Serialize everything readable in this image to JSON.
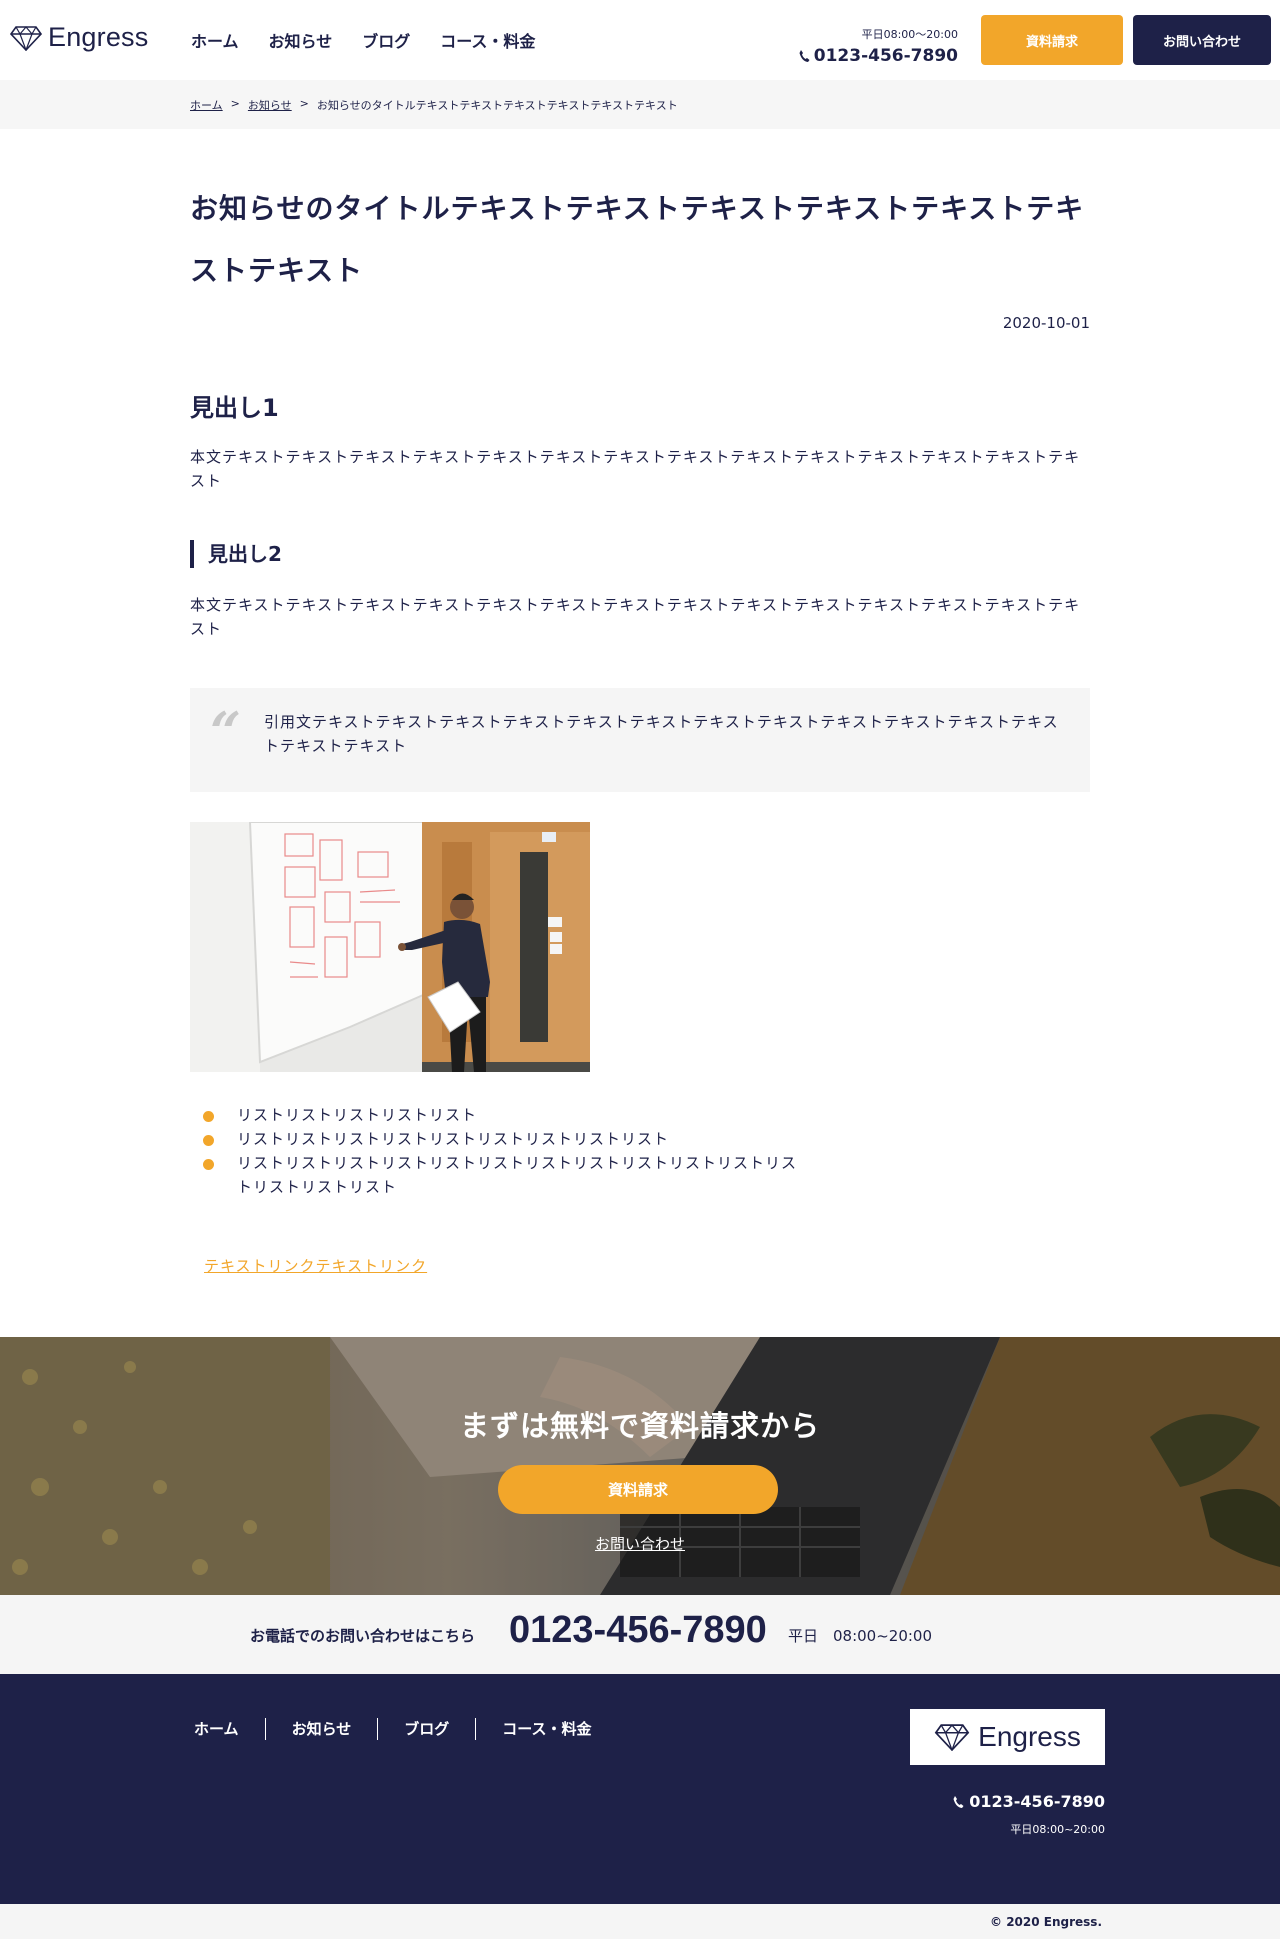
{
  "header": {
    "logo_text": "Engress",
    "nav": [
      "ホーム",
      "お知らせ",
      "ブログ",
      "コース・料金"
    ],
    "hours": "平日08:00〜20:00",
    "phone": "0123-456-7890",
    "doc_button": "資料請求",
    "contact_button": "お問い合わせ"
  },
  "breadcrumb": {
    "home": "ホーム",
    "sep": ">",
    "news": "お知らせ",
    "current": "お知らせのタイトルテキストテキストテキストテキストテキストテキスト"
  },
  "article": {
    "title": "お知らせのタイトルテキストテキストテキストテキストテキストテキストテキスト",
    "date": "2020-10-01",
    "heading1": "見出し1",
    "body1": "本文テキストテキストテキストテキストテキストテキストテキストテキストテキストテキストテキストテキストテキストテキスト",
    "heading2": "見出し2",
    "body2": "本文テキストテキストテキストテキストテキストテキストテキストテキストテキストテキストテキストテキストテキストテキスト",
    "quote_mark": "“",
    "quote": "引用文テキストテキストテキストテキストテキストテキストテキストテキストテキストテキストテキストテキストテキストテキスト",
    "list": [
      "リストリストリストリストリスト",
      "リストリストリストリストリストリストリストリストリスト",
      "リストリストリストリストリストリストリストリストリストリストリストリストリストリストリスト"
    ],
    "link": "テキストリンクテキストリンク"
  },
  "cta": {
    "title": "まずは無料で資料請求から",
    "doc_button": "資料請求",
    "contact_link": "お問い合わせ"
  },
  "phone_band": {
    "label": "お電話でのお問い合わせはこちら",
    "number": "0123-456-7890",
    "hours": "平日　08:00~20:00"
  },
  "footer": {
    "nav": [
      "ホーム",
      "お知らせ",
      "ブログ",
      "コース・料金"
    ],
    "logo_text": "Engress",
    "phone": "0123-456-7890",
    "hours": "平日08:00~20:00",
    "copyright": "© 2020 Engress."
  },
  "colors": {
    "navy": "#1e2148",
    "accent": "#f2a62a",
    "light_bg": "#f5f5f5"
  }
}
